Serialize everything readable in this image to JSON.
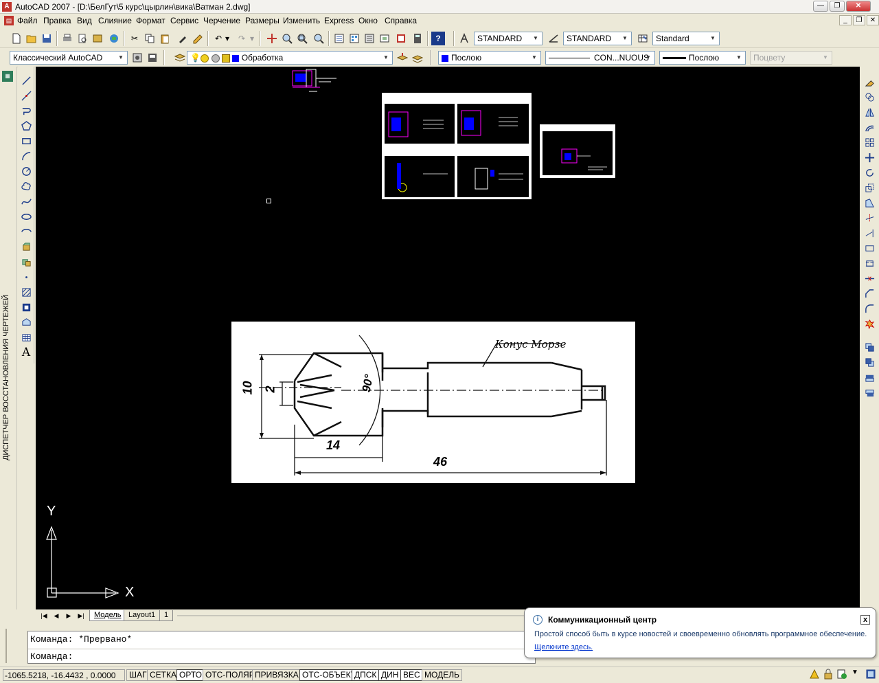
{
  "window": {
    "title": "AutoCAD 2007 - [D:\\БелГут\\5 курс\\цырлин\\вика\\Ватман 2.dwg]",
    "app_icon_letter": "A"
  },
  "menu": {
    "items": [
      "Файл",
      "Правка",
      "Вид",
      "Слияние",
      "Формат",
      "Сервис",
      "Черчение",
      "Размеры",
      "Изменить",
      "Express",
      "Окно",
      "Справка"
    ]
  },
  "toolbar1": {
    "text_style": "STANDARD",
    "dim_style": "STANDARD",
    "table_style": "Standard"
  },
  "toolbar2": {
    "workspace": "Классический AutoCAD",
    "layer": "Обработка",
    "color": "Послою",
    "linetype": "CON...NUOUS",
    "lineweight": "Послою",
    "plotstyle": "Поцвету",
    "layer_color": "#0000ff",
    "color_swatch": "#0000ff"
  },
  "side_panel": {
    "label": "ДИСПЕТЧЕР ВОССТАНОВЛЕНИЯ ЧЕРТЕЖЕЙ"
  },
  "drawing": {
    "annotation_title": "Конус Морзе",
    "dims": {
      "d10": "10",
      "d2": "2",
      "angle": "90°",
      "len14": "14",
      "len46": "46"
    },
    "ucs_y": "Y",
    "ucs_x": "X"
  },
  "tabs": {
    "items": [
      "Модель",
      "Layout1",
      "1"
    ],
    "active": "Модель"
  },
  "command": {
    "line1": "Команда: *Прервано*",
    "line2": "Команда:"
  },
  "status": {
    "coords": "-1065.5218, -16.4432 , 0.0000",
    "buttons": [
      "ШАГ",
      "СЕТКА",
      "ОРТО",
      "ОТС-ПОЛЯР",
      "ПРИВЯЗКА",
      "ОТС-ОБЪЕКТ",
      "ДПСК",
      "ДИН",
      "ВЕС",
      "МОДЕЛЬ"
    ]
  },
  "balloon": {
    "title": "Коммуникационный центр",
    "body": "Простой способ быть в курсе новостей и своевременно обновлять программное обеспечение.",
    "link": "Щелкните здесь.",
    "close": "x"
  }
}
